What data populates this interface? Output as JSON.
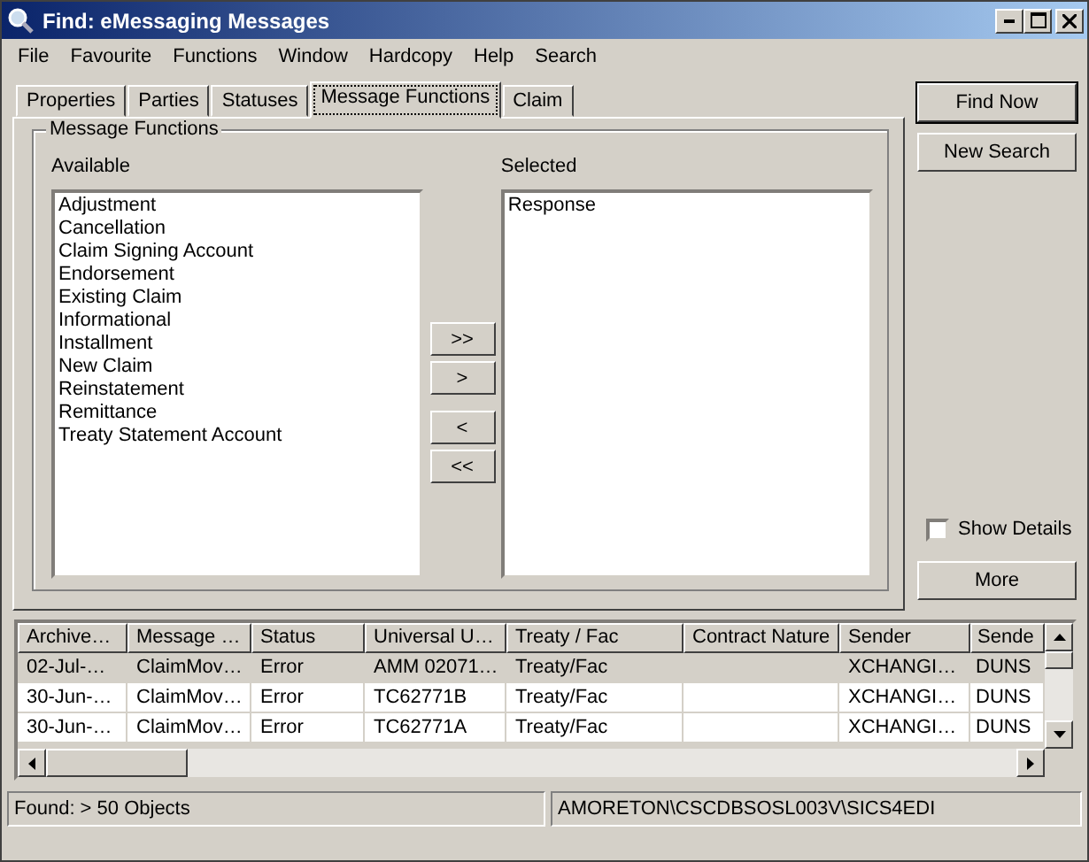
{
  "window": {
    "title": "Find: eMessaging Messages"
  },
  "menu": [
    "File",
    "Favourite",
    "Functions",
    "Window",
    "Hardcopy",
    "Help",
    "Search"
  ],
  "tabs": [
    {
      "label": "Properties",
      "selected": false
    },
    {
      "label": "Parties",
      "selected": false
    },
    {
      "label": "Statuses",
      "selected": false
    },
    {
      "label": "Message Functions",
      "selected": true
    },
    {
      "label": "Claim",
      "selected": false
    }
  ],
  "group": {
    "title": "Message Functions",
    "available_label": "Available",
    "selected_label": "Selected",
    "available": [
      "Adjustment",
      "Cancellation",
      "Claim Signing Account",
      "Endorsement",
      "Existing Claim",
      "Informational",
      "Installment",
      "New Claim",
      "Reinstatement",
      "Remittance",
      "Treaty Statement Account"
    ],
    "selected": [
      "Response"
    ],
    "move_buttons": [
      ">>",
      ">",
      "<",
      "<<"
    ]
  },
  "actions": {
    "find_now": "Find Now",
    "new_search": "New Search",
    "more": "More"
  },
  "show_details": {
    "label": "Show Details",
    "checked": false
  },
  "table": {
    "columns": [
      "Archive…",
      "Message …",
      "Status",
      "Universal U…",
      "Treaty / Fac",
      "Contract Nature",
      "Sender",
      "Sende"
    ],
    "rows": [
      {
        "selected": true,
        "cells": [
          "02-Jul-…",
          "ClaimMov…",
          "Error",
          "AMM 02071…",
          "Treaty/Fac",
          "",
          "XCHANGI…",
          "DUNS"
        ]
      },
      {
        "selected": false,
        "cells": [
          "30-Jun-…",
          "ClaimMov…",
          "Error",
          "TC62771B",
          "Treaty/Fac",
          "",
          "XCHANGI…",
          "DUNS"
        ]
      },
      {
        "selected": false,
        "cells": [
          "30-Jun-…",
          "ClaimMov…",
          "Error",
          "TC62771A",
          "Treaty/Fac",
          "",
          "XCHANGI…",
          "DUNS"
        ]
      }
    ]
  },
  "status_bar": {
    "found": "Found: > 50 Objects",
    "path": "AMORETON\\CSCDBSOSL003V\\SICS4EDI"
  }
}
